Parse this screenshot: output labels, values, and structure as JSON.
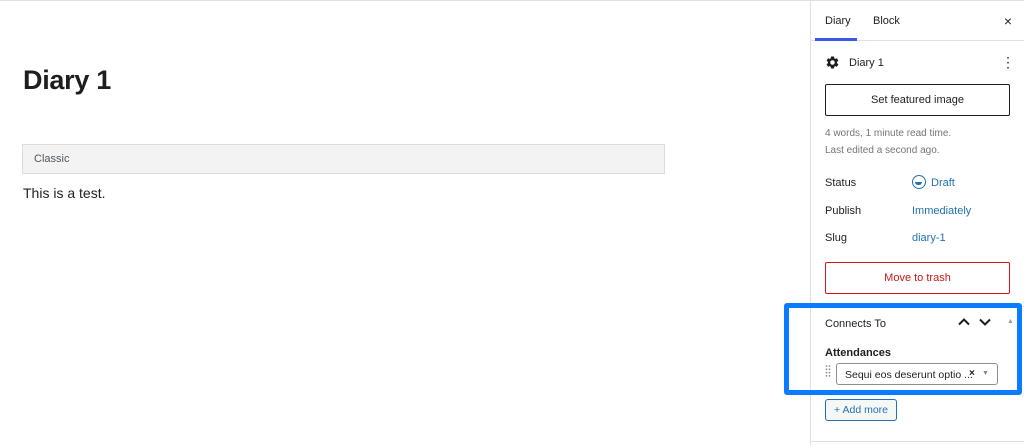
{
  "editor": {
    "title": "Diary 1",
    "block_label": "Classic",
    "content": "This is a test."
  },
  "sidebar": {
    "tabs": [
      {
        "label": "Diary",
        "active": true
      },
      {
        "label": "Block",
        "active": false
      }
    ],
    "close_glyph": "×",
    "doc_name": "Diary 1",
    "more_glyph": "⋮",
    "featured_image_label": "Set featured image",
    "meta_words": "4 words, 1 minute read time.",
    "meta_edited": "Last edited a second ago.",
    "status_label": "Status",
    "status_value": "Draft",
    "publish_label": "Publish",
    "publish_value": "Immediately",
    "slug_label": "Slug",
    "slug_value": "diary-1",
    "trash_label": "Move to trash"
  },
  "connects": {
    "title": "Connects To",
    "collapse_glyph": "▲",
    "field_label": "Attendances",
    "selected_value": "Sequi eos deserunt optio ...",
    "clear_glyph": "×",
    "caret_glyph": "▼",
    "add_more_label": "+ Add more"
  },
  "colors": {
    "accent": "#3858e9",
    "link": "#2271b1",
    "danger": "#cc1818",
    "highlight": "#0a7cff"
  },
  "icons": {
    "settings": "gear-icon",
    "status": "draft-status-icon",
    "move_up": "chevron-up-icon",
    "move_down": "chevron-down-icon",
    "drag": "drag-handle-icon"
  }
}
